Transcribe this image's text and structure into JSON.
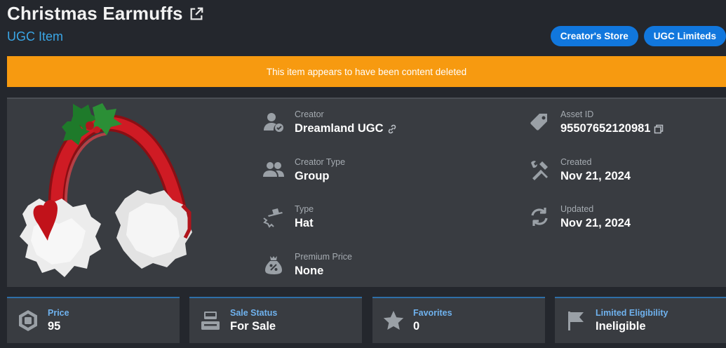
{
  "header": {
    "title": "Christmas Earmuffs",
    "subtitle": "UGC Item"
  },
  "buttons": {
    "creators_store": "Creator's Store",
    "ugc_limiteds": "UGC Limiteds"
  },
  "banner": {
    "text": "This item appears to have been content deleted",
    "color": "#f79a10"
  },
  "details": {
    "creator": {
      "label": "Creator",
      "value": "Dreamland UGC",
      "icon": "creator-verified-icon"
    },
    "creator_type": {
      "label": "Creator Type",
      "value": "Group",
      "icon": "group-icon"
    },
    "type": {
      "label": "Type",
      "value": "Hat",
      "icon": "hat-icon"
    },
    "premium_price": {
      "label": "Premium Price",
      "value": "None",
      "icon": "premium-bag-icon"
    },
    "asset_id": {
      "label": "Asset ID",
      "value": "95507652120981",
      "icon": "tag-icon"
    },
    "created": {
      "label": "Created",
      "value": "Nov 21, 2024",
      "icon": "tools-icon"
    },
    "updated": {
      "label": "Updated",
      "value": "Nov 21, 2024",
      "icon": "refresh-icon"
    }
  },
  "stats": [
    {
      "label": "Price",
      "value": "95",
      "icon": "robux-icon"
    },
    {
      "label": "Sale Status",
      "value": "For Sale",
      "icon": "register-icon"
    },
    {
      "label": "Favorites",
      "value": "0",
      "icon": "star-icon"
    },
    {
      "label": "Limited Eligibility",
      "value": "Ineligible",
      "icon": "flag-icon"
    }
  ],
  "colors": {
    "background": "#24272d",
    "panel": "#393c41",
    "accent": "#1177dd",
    "link": "#3aa6e6"
  }
}
